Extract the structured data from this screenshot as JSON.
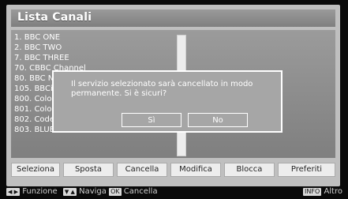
{
  "title": "Lista Canali",
  "channels": [
    "1. BBC ONE",
    "2. BBC TWO",
    "7. BBC THREE",
    "70. CBBC Channel",
    "80. BBC NEWS 24",
    "105. BBCi",
    "800. Color Bars",
    "801. Color Bars",
    "802. Codec1010",
    "803. BLUE/Left1kHz"
  ],
  "dialog": {
    "message": "Il servizio selezionato sarà cancellato in modo permanente. Si è sicuri?",
    "yes_label": "Sì",
    "no_label": "No"
  },
  "function_buttons": [
    "Seleziona",
    "Sposta",
    "Cancella",
    "Modifica",
    "Blocca",
    "Preferiti"
  ],
  "footer": {
    "function_label": "Funzione",
    "navigate_label": "Naviga",
    "ok_key": "OK",
    "delete_label": "Cancella",
    "info_key": "INFO",
    "more_label": "Altro"
  }
}
